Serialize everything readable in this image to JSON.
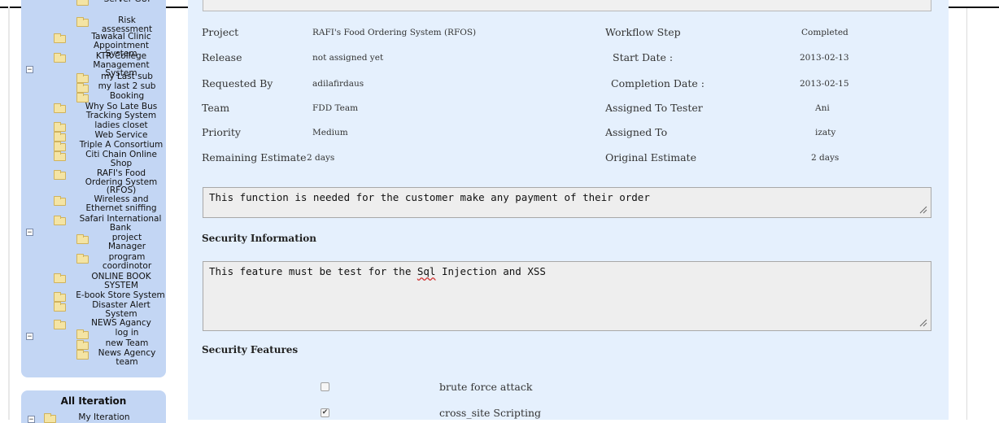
{
  "sidebar": {
    "tree": [
      {
        "label": "Server GUI",
        "level": 2,
        "icon": "folder-icon"
      },
      {
        "label": "Risk assessment",
        "level": 2,
        "icon": "folder-icon"
      },
      {
        "label": "Tawakal Clinic Appointment System",
        "level": 1,
        "icon": "folder-icon"
      },
      {
        "label": "KTR College Management System",
        "level": 1,
        "icon": "folder-icon",
        "expanded": true
      },
      {
        "label": "my Last sub",
        "level": 2,
        "icon": "folder-icon"
      },
      {
        "label": "my last 2 sub",
        "level": 2,
        "icon": "folder-icon"
      },
      {
        "label": "Booking",
        "level": 2,
        "icon": "folder-icon"
      },
      {
        "label": "Why So Late Bus Tracking System",
        "level": 1,
        "icon": "folder-icon"
      },
      {
        "label": "ladies closet",
        "level": 1,
        "icon": "folder-icon"
      },
      {
        "label": "Web Service",
        "level": 1,
        "icon": "folder-icon"
      },
      {
        "label": "Triple A Consortium",
        "level": 1,
        "icon": "folder-icon"
      },
      {
        "label": "Citi Chain Online Shop",
        "level": 1,
        "icon": "folder-icon"
      },
      {
        "label": "RAFI's Food Ordering System (RFOS)",
        "level": 1,
        "icon": "folder-icon"
      },
      {
        "label": "Wireless and Ethernet sniffing",
        "level": 1,
        "icon": "folder-icon"
      },
      {
        "label": "Safari International Bank",
        "level": 1,
        "icon": "folder-icon",
        "expanded": true
      },
      {
        "label": "project Manager",
        "level": 2,
        "icon": "folder-icon"
      },
      {
        "label": "program coordinotor",
        "level": 2,
        "icon": "folder-icon"
      },
      {
        "label": "ONLINE BOOK SYSTEM",
        "level": 1,
        "icon": "folder-icon"
      },
      {
        "label": "E-book Store System",
        "level": 1,
        "icon": "folder-icon"
      },
      {
        "label": "Disaster Alert System",
        "level": 1,
        "icon": "folder-icon"
      },
      {
        "label": "NEWS Agancy",
        "level": 1,
        "icon": "folder-icon",
        "expanded": true
      },
      {
        "label": "log in",
        "level": 2,
        "icon": "folder-icon"
      },
      {
        "label": "new Team",
        "level": 2,
        "icon": "folder-icon"
      },
      {
        "label": "News Agency team",
        "level": 2,
        "icon": "folder-icon"
      }
    ],
    "iteration_title": "All Iteration",
    "iteration_item": "My Iteration"
  },
  "details": {
    "left": [
      {
        "label": "Project",
        "value": "RAFI's Food Ordering System (RFOS)"
      },
      {
        "label": "Release",
        "value": "not assigned yet"
      },
      {
        "label": "Requested By",
        "value": "adilafirdaus"
      },
      {
        "label": "Team",
        "value": "FDD Team"
      },
      {
        "label": "Priority",
        "value": "Medium"
      },
      {
        "label": "Remaining Estimate",
        "value": "2 days"
      }
    ],
    "right": [
      {
        "label": "Workflow Step",
        "value": "Completed"
      },
      {
        "label": "Start Date :",
        "value": "2013-02-13"
      },
      {
        "label": "Completion Date :",
        "value": "2013-02-15"
      },
      {
        "label": "Assigned To Tester",
        "value": "Ani"
      },
      {
        "label": "Assigned To",
        "value": "izaty"
      },
      {
        "label": "Original Estimate",
        "value": "2 days"
      }
    ]
  },
  "description": {
    "text": "This function is needed for the customer make any payment of their order"
  },
  "security_information": {
    "title": "Security Information",
    "text_before": "This feature must be test for the ",
    "text_flagged": "Sql",
    "text_after": " Injection and XSS"
  },
  "security_features": {
    "title": "Security Features",
    "items": [
      {
        "label": "brute force attack",
        "checked": false
      },
      {
        "label": "cross_site Scripting",
        "checked": true
      }
    ]
  },
  "colors": {
    "sidebar_bg": "#c3d6f4",
    "main_bg": "#e5f0fd",
    "folder": "#f4e4a4"
  }
}
